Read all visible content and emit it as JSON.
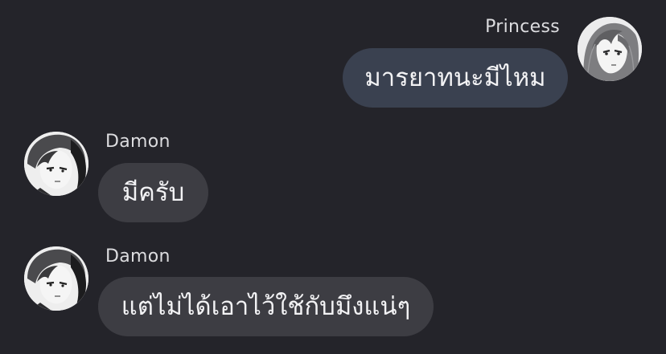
{
  "conversation": {
    "messages": [
      {
        "sender": "Princess",
        "text": "มารยาทนะมีไหม",
        "direction": "outgoing",
        "avatar_icon": "princess-avatar"
      },
      {
        "sender": "Damon",
        "text": "มีครับ",
        "direction": "incoming",
        "avatar_icon": "damon-avatar"
      },
      {
        "sender": "Damon",
        "text": "แต่ไม่ได้เอาไว้ใช้กับมึงแน่ๆ",
        "direction": "incoming",
        "avatar_icon": "damon-avatar"
      }
    ]
  },
  "theme": {
    "background": "#24242a",
    "outgoing_bubble": "#3a4150",
    "incoming_bubble": "#3d3d43",
    "text": "#f2f2f4",
    "name_text": "#dcdcdf"
  }
}
